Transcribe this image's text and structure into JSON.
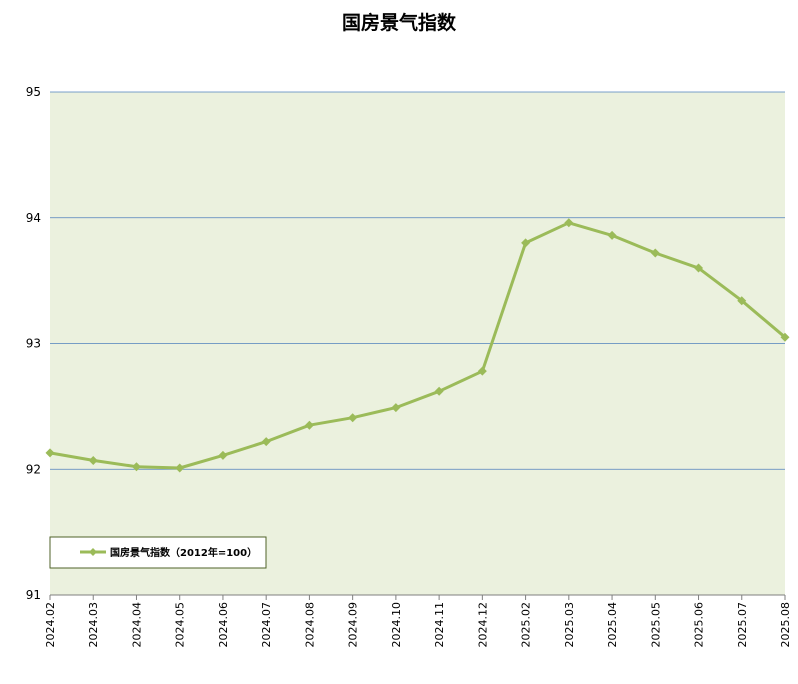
{
  "chart_data": {
    "type": "line",
    "title": "国房景气指数",
    "xlabel": "",
    "ylabel": "",
    "categories": [
      "2024.02",
      "2024.03",
      "2024.04",
      "2024.05",
      "2024.06",
      "2024.07",
      "2024.08",
      "2024.09",
      "2024.10",
      "2024.11",
      "2024.12",
      "2025.02",
      "2025.03",
      "2025.04",
      "2025.05",
      "2025.06",
      "2025.07",
      "2025.08"
    ],
    "series": [
      {
        "name": "国房景气指数（2012年=100）",
        "values": [
          92.13,
          92.07,
          92.02,
          92.01,
          92.11,
          92.22,
          92.35,
          92.41,
          92.49,
          92.62,
          92.78,
          93.8,
          93.96,
          93.86,
          93.72,
          93.6,
          93.34,
          93.05
        ],
        "color": "#9bbb59"
      }
    ],
    "ylim": [
      91,
      95
    ],
    "yticks": [
      "91",
      "92",
      "93",
      "94",
      "95"
    ],
    "grid": true,
    "legend_position": "bottom-left",
    "plot_background": "#ebf1de",
    "gridline_color": "#4f81bd"
  }
}
